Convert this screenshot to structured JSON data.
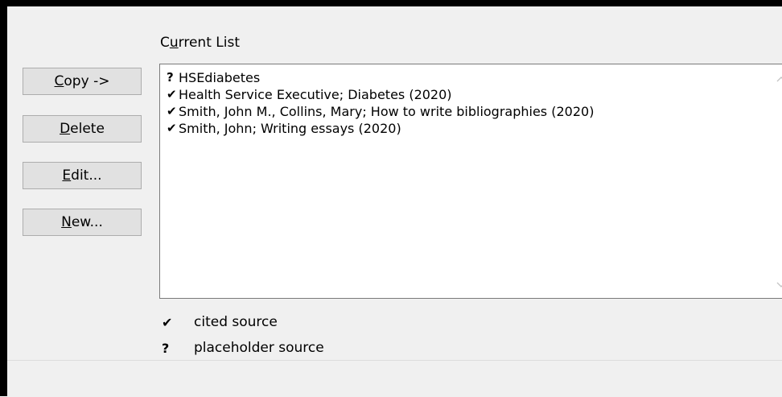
{
  "current_list": {
    "label_prefix": "C",
    "label_underlined": "u",
    "label_suffix": "rrent List",
    "items": [
      {
        "mark": "?",
        "text": "HSEdiabetes"
      },
      {
        "mark": "✔",
        "text": "Health Service Executive; Diabetes (2020)"
      },
      {
        "mark": "✔",
        "text": "Smith, John M., Collins, Mary; How to write bibliographies (2020)"
      },
      {
        "mark": "✔",
        "text": "Smith, John; Writing essays (2020)"
      }
    ]
  },
  "buttons": {
    "copy": {
      "accel": "C",
      "rest": "opy ->"
    },
    "delete": {
      "accel": "D",
      "rest": "elete"
    },
    "edit": {
      "accel": "E",
      "rest": "dit..."
    },
    "new": {
      "accel": "N",
      "rest": "ew..."
    }
  },
  "legend": {
    "cited": {
      "mark": "✔",
      "label": "cited source"
    },
    "placeholder": {
      "mark": "?",
      "label": "placeholder source"
    }
  },
  "icons": {
    "scroll_up": "chevron-up-icon",
    "scroll_down": "chevron-down-icon"
  },
  "colors": {
    "dialog_bg": "#f0f0f0",
    "button_bg": "#e1e1e1",
    "button_border": "#adadad",
    "list_border": "#7a7a7a",
    "scroll_arrow": "#c3c3c3"
  }
}
